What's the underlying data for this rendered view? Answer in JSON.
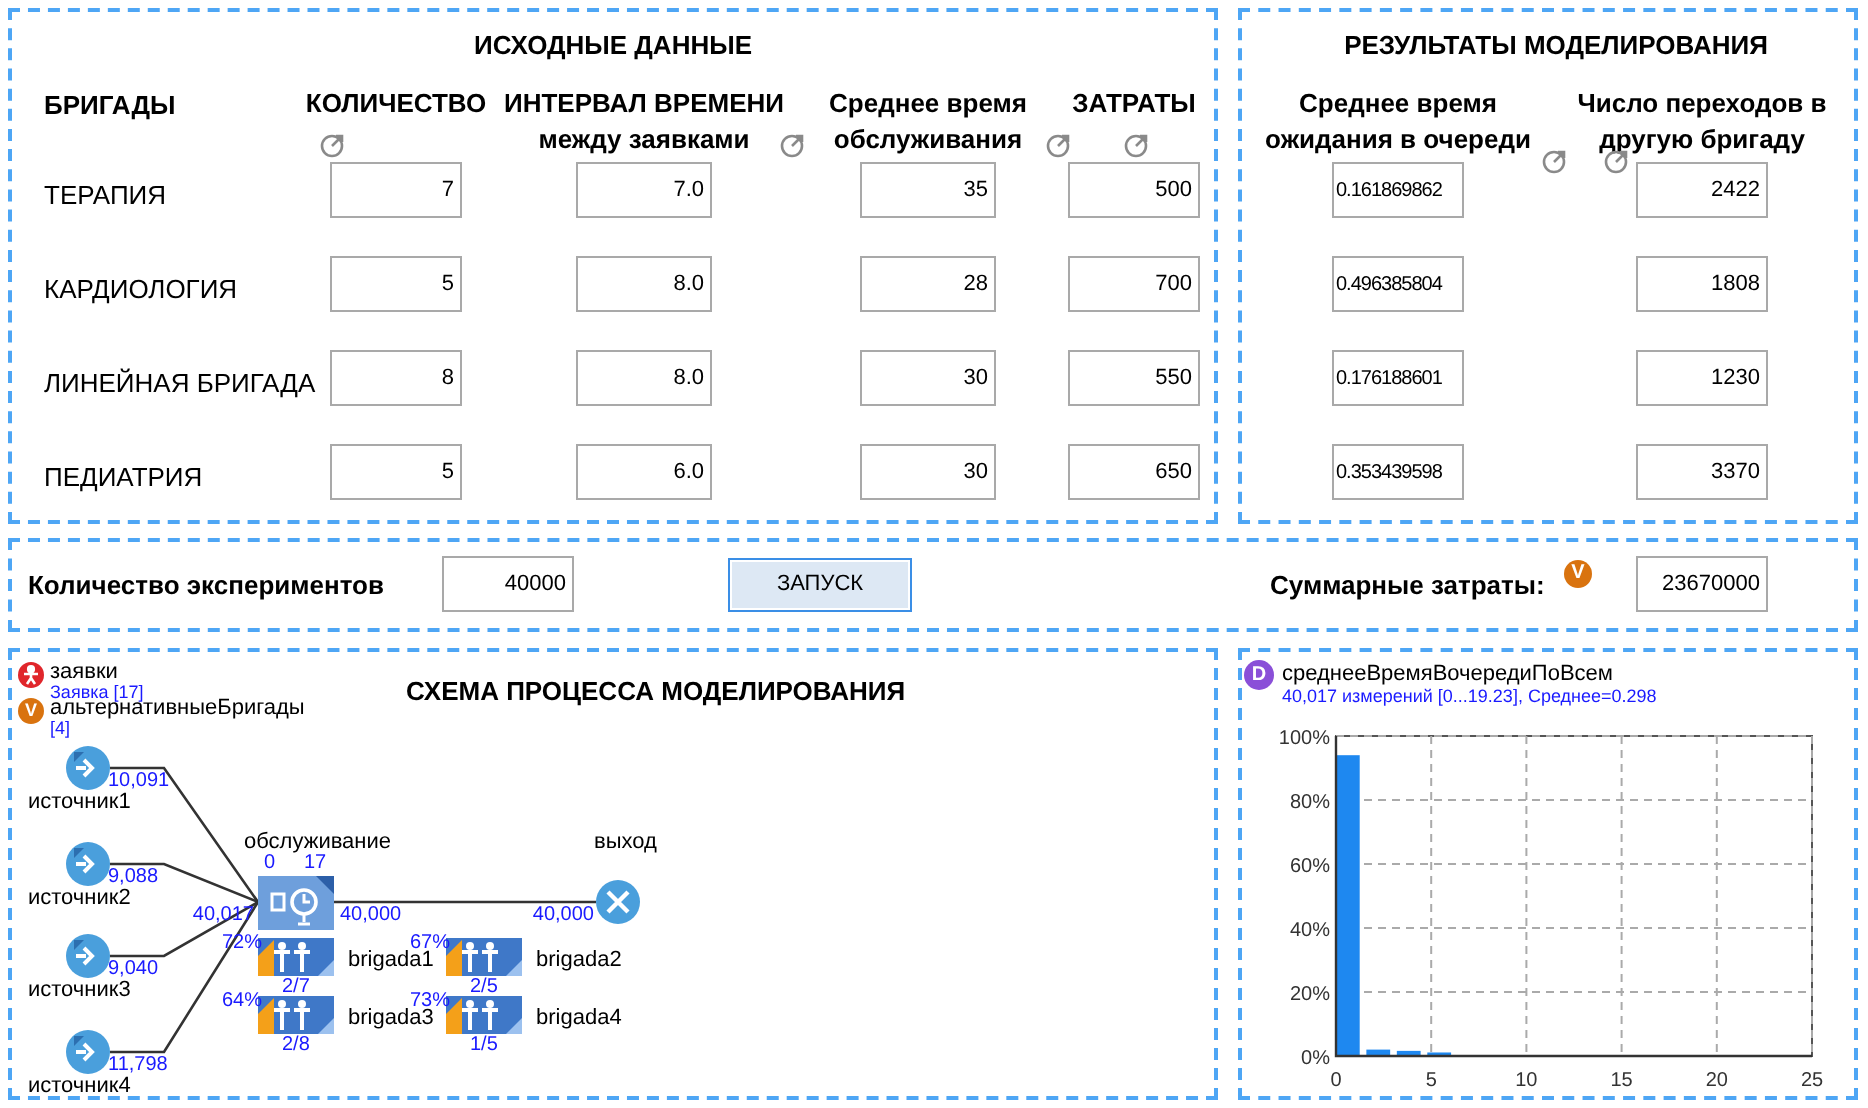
{
  "input_data": {
    "title": "ИСХОДНЫЕ ДАННЫЕ",
    "row_header": "БРИГАДЫ",
    "columns": [
      {
        "lines": [
          "КОЛИЧЕСТВО"
        ]
      },
      {
        "lines": [
          "ИНТЕРВАЛ ВРЕМЕНИ",
          "между заявками"
        ]
      },
      {
        "lines": [
          "Среднее время",
          "обслуживания"
        ]
      },
      {
        "lines": [
          "ЗАТРАТЫ"
        ]
      }
    ],
    "rows": [
      {
        "brigade": "ТЕРАПИЯ",
        "values": [
          "7",
          "7.0",
          "35",
          "500"
        ]
      },
      {
        "brigade": "КАРДИОЛОГИЯ",
        "values": [
          "5",
          "8.0",
          "28",
          "700"
        ]
      },
      {
        "brigade": "ЛИНЕЙНАЯ БРИГАДА",
        "values": [
          "8",
          "8.0",
          "30",
          "550"
        ]
      },
      {
        "brigade": "ПЕДИАТРИЯ",
        "values": [
          "5",
          "6.0",
          "30",
          "650"
        ]
      }
    ]
  },
  "results": {
    "title": "РЕЗУЛЬТАТЫ МОДЕЛИРОВАНИЯ",
    "columns": [
      {
        "lines": [
          "Среднее время",
          "ожидания в очереди"
        ]
      },
      {
        "lines": [
          "Число переходов в",
          "другую бригаду"
        ]
      }
    ],
    "rows": [
      [
        "0.161869862",
        "2422"
      ],
      [
        "0.496385804",
        "1808"
      ],
      [
        "0.176188601",
        "1230"
      ],
      [
        "0.353439598",
        "3370"
      ]
    ]
  },
  "controls": {
    "experiments_label": "Количество экспериментов",
    "experiments_value": "40000",
    "run_button": "ЗАПУСК",
    "total_cost_label": "Суммарные затраты:",
    "total_cost_badge": "V",
    "total_cost_value": "23670000"
  },
  "diagram": {
    "title": "СХЕМА ПРОЦЕССА МОДЕЛИРОВАНИЯ",
    "legend": [
      {
        "kind": "agent",
        "name": "заявки",
        "detail": "Заявка [17]"
      },
      {
        "kind": "variable",
        "badge": "V",
        "name": "альтернативныеБригады",
        "detail": "[4]"
      }
    ],
    "sources": [
      {
        "name": "источник1",
        "count": "10,091"
      },
      {
        "name": "источник2",
        "count": "9,088"
      },
      {
        "name": "источник3",
        "count": "9,040"
      },
      {
        "name": "источник4",
        "count": "11,798"
      }
    ],
    "service": {
      "name": "обслуживание",
      "queue": "0",
      "busy": "17",
      "in_count": "40,017",
      "out_count": "40,000"
    },
    "sink": {
      "name": "выход",
      "count": "40,000"
    },
    "pools": [
      {
        "name": "brigada1",
        "utilization": "72%",
        "usage": "2/7"
      },
      {
        "name": "brigada2",
        "utilization": "67%",
        "usage": "2/5"
      },
      {
        "name": "brigada3",
        "utilization": "64%",
        "usage": "2/8"
      },
      {
        "name": "brigada4",
        "utilization": "73%",
        "usage": "1/5"
      }
    ]
  },
  "histogram": {
    "badge": "D",
    "title": "среднееВремяВочередиПоВсем",
    "summary": "40,017 измерений [0...19.23], Среднее=0.298",
    "chart_data": {
      "type": "bar",
      "grid": true,
      "x": [
        0.62,
        2.22,
        3.82,
        5.42
      ],
      "values": [
        94,
        2,
        1.6,
        1.1
      ],
      "xlim": [
        0,
        25
      ],
      "ylim": [
        0,
        100
      ],
      "xticks": [
        0,
        5,
        10,
        15,
        20,
        25
      ],
      "yticks": [
        {
          "value": 0,
          "label": "0%"
        },
        {
          "value": 20,
          "label": "20%"
        },
        {
          "value": 40,
          "label": "40%"
        },
        {
          "value": 60,
          "label": "60%"
        },
        {
          "value": 80,
          "label": "80%"
        },
        {
          "value": 100,
          "label": "100%"
        }
      ]
    }
  }
}
